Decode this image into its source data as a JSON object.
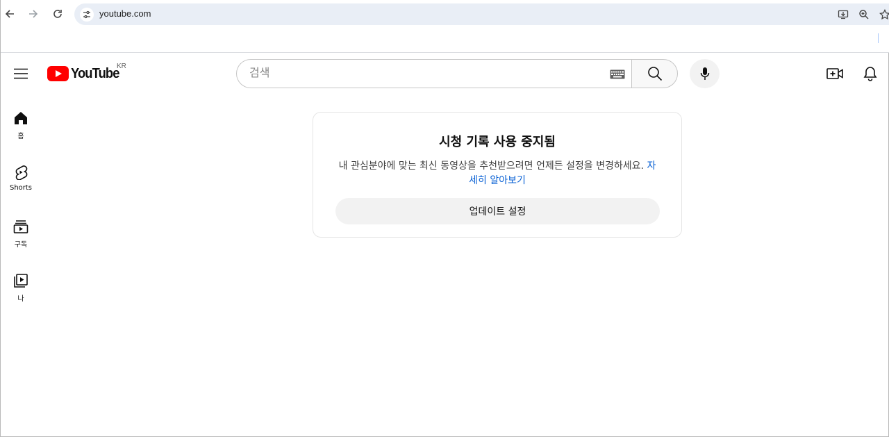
{
  "browser": {
    "url": "youtube.com"
  },
  "header": {
    "logo_text": "YouTube",
    "country_code": "KR",
    "search_placeholder": "검색"
  },
  "sidebar": {
    "items": [
      {
        "label": "홈",
        "icon": "home-icon"
      },
      {
        "label": "Shorts",
        "icon": "shorts-icon"
      },
      {
        "label": "구독",
        "icon": "subscriptions-icon"
      },
      {
        "label": "나",
        "icon": "you-icon"
      }
    ]
  },
  "card": {
    "title": "시청 기록 사용 중지됨",
    "body": "내 관심분야에 맞는 최신 동영상을 추천받으려면 언제든 설정을 변경하세요.",
    "link": "자세히 알아보기",
    "button": "업데이트 설정"
  },
  "colors": {
    "brand_red": "#ff0000",
    "link_blue": "#065fd4",
    "omnibox_bg": "#e9eef6"
  }
}
